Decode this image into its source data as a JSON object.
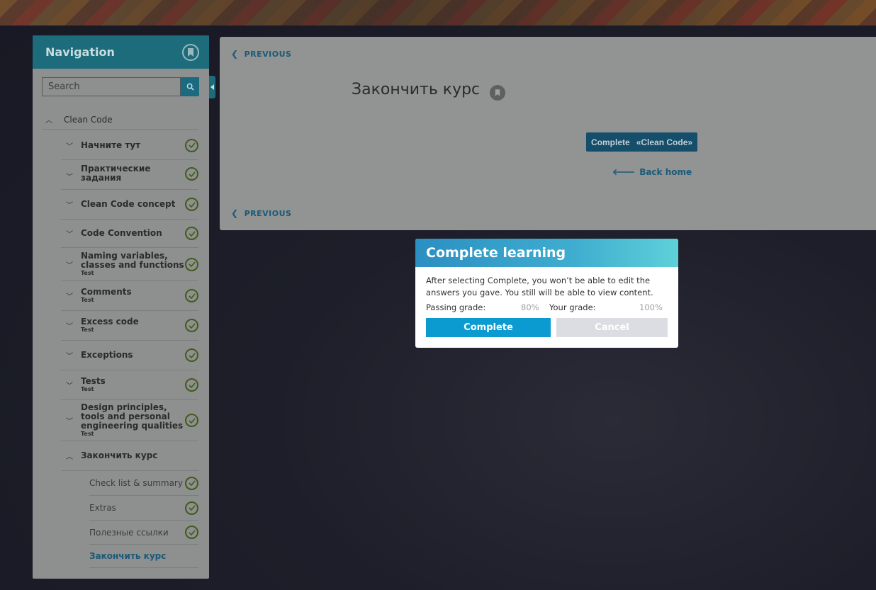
{
  "nav": {
    "title": "Navigation",
    "search_placeholder": "Search",
    "root": {
      "label": "Clean Code"
    },
    "items": [
      {
        "label": "Начните тут",
        "sub": ""
      },
      {
        "label": "Практические задания",
        "sub": ""
      },
      {
        "label": "Clean Code concept",
        "sub": ""
      },
      {
        "label": "Code Convention",
        "sub": ""
      },
      {
        "label": "Naming variables, classes and functions",
        "sub": "Test"
      },
      {
        "label": "Comments",
        "sub": "Test"
      },
      {
        "label": "Excess code",
        "sub": "Test"
      },
      {
        "label": "Exceptions",
        "sub": ""
      },
      {
        "label": "Tests",
        "sub": "Test"
      },
      {
        "label": "Design principles, tools and personal engineering qualities",
        "sub": "Test"
      },
      {
        "label": "Закончить курс",
        "sub": ""
      }
    ],
    "subitems": [
      {
        "label": "Check list & summary"
      },
      {
        "label": "Extras"
      },
      {
        "label": "Полезные ссылки"
      },
      {
        "label": "Закончить курс"
      }
    ]
  },
  "main": {
    "previous_label": "PREVIOUS",
    "heading": "Закончить курс",
    "complete_btn": {
      "label": "Complete",
      "course": "«Clean Code»"
    },
    "back_home": "Back home"
  },
  "modal": {
    "title": "Complete learning",
    "message": "After selecting Complete, you won’t be able to edit the answers you gave. You still will be able to view content.",
    "passing_label": "Passing grade:",
    "passing_value": "80%",
    "your_label": "Your grade:",
    "your_value": "100%",
    "complete_label": "Complete",
    "cancel_label": "Cancel"
  },
  "colors": {
    "accent": "#0b9bd1",
    "nav_header": "#1c6c7c",
    "check_green": "#3f5c1a",
    "link": "#1a5a78"
  }
}
